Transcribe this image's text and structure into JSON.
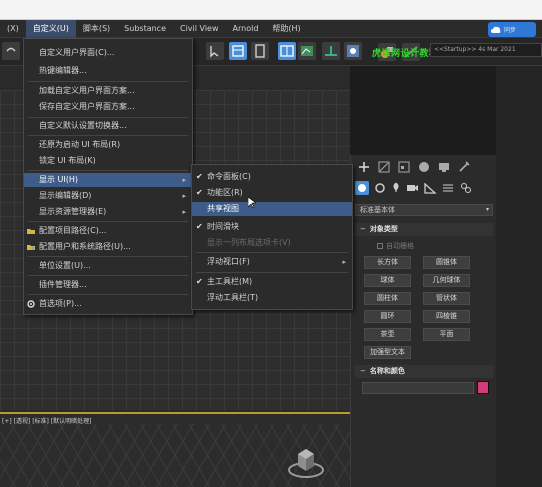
{
  "menubar": {
    "items": [
      "(X)",
      "自定义(U)",
      "脚本(S)",
      "Substance",
      "Civil View",
      "Arnold",
      "帮助(H)"
    ],
    "cloud_button_label": "同步"
  },
  "toolbar": {
    "watermark": "虎课网设计教程",
    "workspace": "<<Startup>> 4s Mar 2021"
  },
  "main_menu": {
    "items": [
      {
        "label": "自定义用户界面(C)...",
        "icon": "none",
        "arrow": false
      },
      {
        "label": "热键编辑器...",
        "icon": "none",
        "arrow": false
      },
      {
        "label": "加载自定义用户界面方案...",
        "icon": "none",
        "arrow": false
      },
      {
        "label": "保存自定义用户界面方案...",
        "icon": "none",
        "arrow": false
      },
      {
        "label": "自定义默认设置切换器...",
        "icon": "none",
        "arrow": false
      },
      {
        "label": "还原为启动 UI 布局(R)",
        "icon": "none",
        "arrow": false
      },
      {
        "label": "锁定 UI 布局(K)",
        "icon": "none",
        "arrow": false
      },
      {
        "label": "显示 UI(H)",
        "icon": "none",
        "arrow": true
      },
      {
        "label": "显示编辑器(D)",
        "icon": "none",
        "arrow": true
      },
      {
        "label": "显示资源管理器(E)",
        "icon": "none",
        "arrow": true
      },
      {
        "label": "配置项目路径(C)...",
        "icon": "folder-icon",
        "arrow": false
      },
      {
        "label": "配置用户和系统路径(U)...",
        "icon": "user-folder-icon",
        "arrow": false
      },
      {
        "label": "单位设置(U)...",
        "icon": "none",
        "arrow": false
      },
      {
        "label": "插件管理器...",
        "icon": "none",
        "arrow": false
      },
      {
        "label": "首选项(P)...",
        "icon": "gear-icon",
        "arrow": false
      }
    ]
  },
  "sub_menu": {
    "items": [
      {
        "label": "命令面板(C)",
        "checked": true,
        "arrow": false,
        "dim": false
      },
      {
        "label": "功能区(R)",
        "checked": true,
        "arrow": false,
        "dim": false
      },
      {
        "label": "共享视图",
        "checked": false,
        "arrow": false,
        "dim": false
      },
      {
        "label": "时间滑块",
        "checked": true,
        "arrow": false,
        "dim": false
      },
      {
        "label": "显示一列布局选项卡(V)",
        "checked": false,
        "arrow": false,
        "dim": true
      },
      {
        "label": "浮动视口(F)",
        "checked": false,
        "arrow": true,
        "dim": false
      },
      {
        "label": "主工具栏(M)",
        "checked": true,
        "arrow": false,
        "dim": false
      },
      {
        "label": "浮动工具栏(T)",
        "checked": false,
        "arrow": false,
        "dim": false
      }
    ]
  },
  "command_panel": {
    "dropdown": "标准基本体",
    "object_type_header": "对象类型",
    "autogrid_label": "自动栅格",
    "buttons": [
      "长方体",
      "圆锥体",
      "球体",
      "几何球体",
      "圆柱体",
      "管状体",
      "圆环",
      "四棱锥",
      "茶壶",
      "平面",
      "加强型文本"
    ],
    "name_color_header": "名称和颜色",
    "swatch_color": "#d23a7a"
  },
  "viewport": {
    "persp_label": "[+] [透视] [标准] [默认明暗处理]",
    "top_label": "[+]"
  },
  "colors": {
    "highlight": "#3d5c8a",
    "accent_blue": "#4a8fd8",
    "active_viewport_border": "#b79a2c"
  }
}
